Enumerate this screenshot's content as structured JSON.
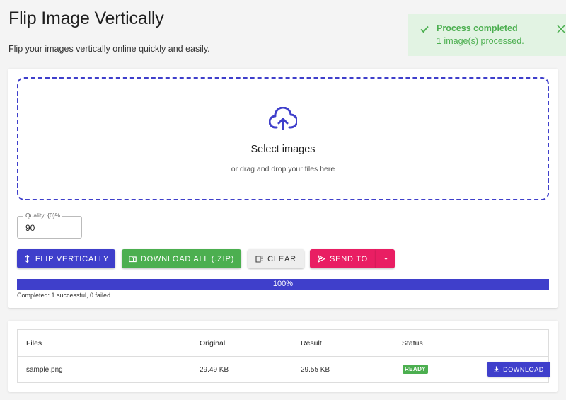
{
  "page": {
    "title": "Flip Image Vertically",
    "subtitle": "Flip your images vertically online quickly and easily."
  },
  "toast": {
    "title": "Process completed",
    "message": "1 image(s) processed.",
    "icon": "check-icon",
    "close_icon": "close-icon"
  },
  "dropzone": {
    "icon": "cloud-upload-icon",
    "label": "Select images",
    "hint": "or drag and drop your files here"
  },
  "quality": {
    "label": "Quality: {0}%",
    "value": "90"
  },
  "actions": {
    "flip": "FLIP VERTICALLY",
    "download_all": "DOWNLOAD ALL (.ZIP)",
    "clear": "CLEAR",
    "send_to": "SEND TO"
  },
  "progress": {
    "percent": 100,
    "label": "100%",
    "summary": "Completed: 1 successful, 0 failed."
  },
  "table": {
    "headers": [
      "Files",
      "Original",
      "Result",
      "Status"
    ],
    "rows": [
      {
        "file": "sample.png",
        "original": "29.49 KB",
        "result": "29.55 KB",
        "status": "READY",
        "action": "DOWNLOAD"
      }
    ]
  },
  "colors": {
    "primary": "#3f3fcb",
    "success": "#4caf50",
    "accent": "#e91e63",
    "toast_bg": "#e2f3e3"
  }
}
